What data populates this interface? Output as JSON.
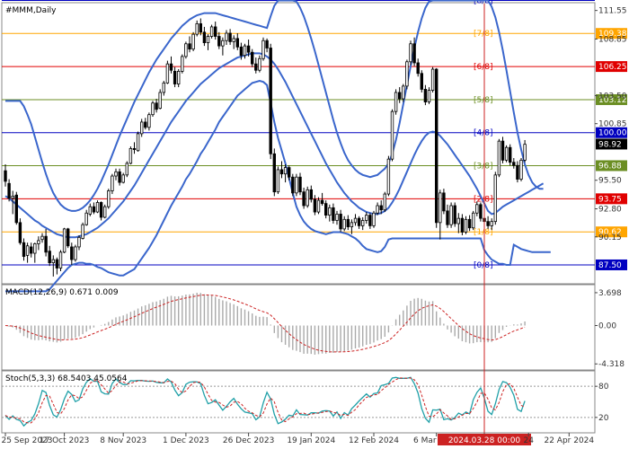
{
  "chart_data": {
    "type": "candlestick",
    "title": "#MMM,Daily",
    "price_ylim": [
      85.8,
      112.2
    ],
    "price_ticks": [
      111.55,
      108.85,
      103.5,
      100.85,
      95.5,
      92.8,
      90.15
    ],
    "x_tick_labels": [
      "25 Sep 2023",
      "17 Oct 2023",
      "8 Nov 2023",
      "1 Dec 2023",
      "26 Dec 2023",
      "19 Jan 2024",
      "12 Feb 2024",
      "6 Mar 2024",
      "2024.03.28 00:00",
      "24",
      "22 Apr 2024"
    ],
    "x_tick_indices": [
      0,
      16,
      32,
      49,
      66,
      83,
      100,
      117,
      130,
      142,
      153
    ],
    "crosshair_index": 130,
    "current_price": 98.92,
    "murrey_levels": [
      {
        "label": "[8/8]",
        "value": 112.5,
        "price_label": "",
        "color": "#0000c0"
      },
      {
        "label": "[7/8]",
        "value": 109.38,
        "price_label": "109.38",
        "color": "#ffa500"
      },
      {
        "label": "[6/8]",
        "value": 106.25,
        "price_label": "106.25",
        "color": "#e00000"
      },
      {
        "label": "[5/8]",
        "value": 103.12,
        "price_label": "103.12",
        "color": "#6b8e23"
      },
      {
        "label": "[4/8]",
        "value": 100.0,
        "price_label": "100.00",
        "color": "#0000c0"
      },
      {
        "label": "[3/8]",
        "value": 96.88,
        "price_label": "96.88",
        "color": "#6b8e23"
      },
      {
        "label": "[2/8]",
        "value": 93.75,
        "price_label": "93.75",
        "color": "#e00000"
      },
      {
        "label": "[1/8]",
        "value": 90.62,
        "price_label": "90.62",
        "color": "#ffa500"
      },
      {
        "label": "[0/8]",
        "value": 87.5,
        "price_label": "87.50",
        "color": "#0000c0"
      }
    ],
    "macd": {
      "label": "MACD(12,26,9) 0.671 0.009",
      "ylim": [
        -4.9,
        4.5
      ],
      "ticks": [
        3.698,
        0.0,
        -4.318
      ]
    },
    "stoch": {
      "label": "Stoch(5,3,3) 68.5403 45.0564",
      "ylim": [
        -8,
        108
      ],
      "ticks": [
        80,
        20
      ],
      "levels": [
        80,
        20
      ]
    },
    "candles": [
      [
        96.4,
        97.0,
        94.9,
        95.4
      ],
      [
        95.2,
        95.6,
        93.5,
        93.8
      ],
      [
        93.8,
        94.5,
        92.3,
        94.0
      ],
      [
        94.1,
        94.4,
        91.3,
        91.5
      ],
      [
        91.5,
        91.9,
        89.4,
        89.6
      ],
      [
        89.6,
        90.0,
        87.9,
        88.3
      ],
      [
        88.4,
        89.6,
        87.7,
        89.3
      ],
      [
        89.2,
        89.6,
        88.2,
        88.6
      ],
      [
        88.6,
        89.6,
        87.7,
        89.5
      ],
      [
        89.5,
        90.2,
        88.9,
        89.8
      ],
      [
        89.9,
        90.5,
        89.6,
        90.2
      ],
      [
        90.2,
        90.9,
        88.3,
        88.7
      ],
      [
        88.8,
        89.3,
        87.4,
        87.7
      ],
      [
        87.7,
        88.4,
        86.4,
        88.0
      ],
      [
        88.0,
        88.2,
        86.6,
        87.2
      ],
      [
        87.2,
        88.9,
        86.9,
        88.7
      ],
      [
        88.7,
        91.0,
        88.6,
        90.9
      ],
      [
        90.9,
        91.0,
        89.1,
        89.3
      ],
      [
        89.2,
        89.6,
        87.5,
        88.0
      ],
      [
        88.0,
        89.4,
        87.8,
        89.2
      ],
      [
        89.2,
        90.3,
        88.9,
        90.1
      ],
      [
        90.0,
        91.5,
        89.9,
        91.3
      ],
      [
        91.3,
        92.7,
        91.2,
        92.4
      ],
      [
        92.3,
        93.3,
        92.1,
        93.0
      ],
      [
        93.0,
        93.4,
        92.3,
        92.5
      ],
      [
        92.5,
        93.6,
        92.4,
        93.4
      ],
      [
        93.4,
        93.5,
        91.7,
        92.0
      ],
      [
        92.0,
        93.2,
        91.9,
        93.0
      ],
      [
        93.0,
        94.7,
        92.8,
        94.5
      ],
      [
        94.5,
        96.1,
        94.2,
        95.9
      ],
      [
        95.9,
        96.6,
        95.5,
        96.3
      ],
      [
        96.3,
        96.6,
        95.0,
        95.3
      ],
      [
        95.3,
        96.2,
        95.2,
        96.0
      ],
      [
        96.0,
        97.3,
        95.8,
        97.1
      ],
      [
        97.1,
        98.7,
        97.0,
        98.5
      ],
      [
        98.5,
        99.1,
        98.0,
        98.4
      ],
      [
        98.3,
        100.1,
        98.2,
        99.9
      ],
      [
        99.9,
        101.3,
        99.6,
        101.0
      ],
      [
        101.0,
        101.4,
        100.3,
        100.5
      ],
      [
        100.5,
        101.9,
        100.2,
        101.7
      ],
      [
        101.7,
        103.0,
        101.5,
        102.8
      ],
      [
        102.8,
        103.2,
        101.9,
        102.2
      ],
      [
        102.3,
        104.1,
        102.2,
        103.8
      ],
      [
        103.8,
        104.9,
        103.5,
        104.7
      ],
      [
        104.7,
        106.8,
        104.6,
        106.5
      ],
      [
        106.5,
        107.2,
        105.6,
        105.9
      ],
      [
        105.8,
        106.2,
        104.3,
        104.6
      ],
      [
        104.6,
        106.0,
        104.3,
        105.8
      ],
      [
        105.8,
        107.4,
        105.6,
        107.2
      ],
      [
        107.2,
        108.6,
        107.0,
        108.4
      ],
      [
        108.4,
        109.1,
        107.6,
        107.9
      ],
      [
        107.9,
        109.5,
        107.7,
        109.3
      ],
      [
        109.3,
        110.6,
        109.1,
        110.3
      ],
      [
        110.3,
        110.8,
        109.2,
        109.5
      ],
      [
        109.5,
        110.0,
        108.2,
        108.5
      ],
      [
        108.5,
        109.3,
        107.8,
        109.1
      ],
      [
        109.1,
        110.2,
        108.9,
        110.0
      ],
      [
        110.0,
        110.5,
        108.8,
        109.1
      ],
      [
        109.1,
        109.5,
        107.9,
        108.2
      ],
      [
        108.2,
        109.0,
        107.3,
        108.7
      ],
      [
        108.7,
        109.7,
        108.3,
        109.4
      ],
      [
        109.4,
        109.8,
        108.3,
        108.6
      ],
      [
        108.6,
        109.2,
        107.9,
        108.9
      ],
      [
        108.9,
        109.4,
        107.8,
        108.1
      ],
      [
        108.1,
        108.5,
        106.9,
        107.3
      ],
      [
        107.3,
        108.4,
        107.0,
        108.2
      ],
      [
        108.2,
        108.8,
        107.2,
        107.6
      ],
      [
        107.6,
        107.9,
        106.2,
        106.5
      ],
      [
        106.5,
        107.1,
        105.6,
        105.9
      ],
      [
        105.9,
        107.3,
        105.7,
        107.0
      ],
      [
        107.0,
        109.0,
        106.8,
        108.7
      ],
      [
        108.7,
        108.9,
        107.6,
        108.0
      ],
      [
        108.0,
        108.4,
        97.5,
        98.0
      ],
      [
        98.0,
        98.5,
        94.0,
        94.4
      ],
      [
        94.4,
        96.8,
        94.2,
        96.5
      ],
      [
        96.5,
        97.3,
        95.7,
        96.1
      ],
      [
        96.1,
        97.0,
        95.3,
        96.7
      ],
      [
        96.7,
        96.9,
        95.5,
        95.8
      ],
      [
        95.8,
        96.1,
        94.0,
        94.3
      ],
      [
        94.3,
        96.1,
        94.0,
        95.8
      ],
      [
        95.8,
        96.2,
        94.1,
        94.4
      ],
      [
        94.4,
        94.8,
        92.8,
        93.1
      ],
      [
        93.1,
        94.9,
        92.9,
        94.6
      ],
      [
        94.6,
        95.0,
        93.4,
        93.7
      ],
      [
        93.7,
        94.1,
        92.2,
        92.5
      ],
      [
        92.5,
        93.9,
        92.3,
        93.6
      ],
      [
        93.6,
        94.3,
        93.1,
        93.3
      ],
      [
        93.3,
        93.6,
        91.9,
        92.2
      ],
      [
        92.2,
        93.2,
        91.6,
        92.9
      ],
      [
        92.9,
        93.3,
        91.4,
        91.7
      ],
      [
        91.7,
        92.6,
        91.3,
        92.3
      ],
      [
        92.3,
        92.7,
        90.6,
        90.9
      ],
      [
        90.9,
        92.1,
        90.7,
        91.8
      ],
      [
        91.8,
        92.2,
        90.8,
        91.1
      ],
      [
        91.1,
        91.8,
        90.4,
        91.5
      ],
      [
        91.5,
        92.3,
        91.2,
        91.9
      ],
      [
        91.9,
        92.1,
        90.9,
        91.2
      ],
      [
        91.2,
        92.0,
        90.8,
        91.7
      ],
      [
        91.7,
        92.5,
        91.4,
        92.2
      ],
      [
        92.2,
        92.4,
        90.9,
        91.2
      ],
      [
        91.2,
        92.6,
        91.0,
        92.4
      ],
      [
        92.4,
        93.4,
        92.2,
        93.1
      ],
      [
        93.1,
        93.6,
        92.3,
        92.7
      ],
      [
        92.7,
        94.4,
        92.5,
        94.2
      ],
      [
        94.2,
        97.8,
        94.0,
        97.5
      ],
      [
        97.5,
        102.2,
        97.3,
        102.0
      ],
      [
        102.0,
        104.1,
        101.7,
        103.8
      ],
      [
        103.8,
        104.3,
        102.8,
        103.2
      ],
      [
        103.2,
        104.6,
        102.9,
        104.4
      ],
      [
        104.4,
        106.9,
        104.1,
        106.7
      ],
      [
        106.7,
        108.7,
        106.4,
        108.4
      ],
      [
        108.4,
        109.0,
        106.3,
        106.6
      ],
      [
        106.6,
        107.0,
        105.3,
        105.6
      ],
      [
        105.6,
        105.9,
        103.8,
        104.1
      ],
      [
        104.1,
        104.5,
        102.6,
        102.9
      ],
      [
        102.9,
        104.3,
        102.7,
        104.0
      ],
      [
        104.0,
        106.2,
        103.8,
        106.0
      ],
      [
        106.0,
        106.1,
        91.0,
        91.5
      ],
      [
        91.5,
        94.6,
        89.9,
        94.3
      ],
      [
        94.3,
        94.7,
        92.3,
        92.6
      ],
      [
        92.6,
        93.2,
        91.0,
        91.3
      ],
      [
        91.3,
        93.4,
        91.0,
        93.1
      ],
      [
        93.1,
        93.4,
        91.1,
        91.4
      ],
      [
        91.4,
        92.4,
        90.5,
        91.9
      ],
      [
        91.9,
        92.3,
        90.3,
        90.6
      ],
      [
        90.6,
        92.1,
        90.4,
        91.8
      ],
      [
        91.8,
        92.2,
        90.7,
        91.0
      ],
      [
        91.0,
        92.6,
        90.8,
        92.4
      ],
      [
        92.4,
        93.5,
        92.1,
        93.2
      ],
      [
        93.2,
        93.4,
        91.6,
        91.9
      ],
      [
        91.9,
        92.3,
        91.1,
        91.6
      ],
      [
        91.6,
        92.1,
        90.9,
        91.2
      ],
      [
        91.2,
        91.9,
        90.8,
        91.6
      ],
      [
        91.6,
        96.3,
        91.3,
        96.0
      ],
      [
        96.0,
        99.4,
        95.8,
        99.2
      ],
      [
        99.2,
        99.6,
        97.1,
        97.4
      ],
      [
        97.4,
        98.8,
        97.2,
        98.6
      ],
      [
        98.6,
        98.9,
        96.9,
        97.2
      ],
      [
        97.2,
        97.6,
        96.6,
        96.9
      ],
      [
        96.9,
        97.3,
        95.3,
        95.6
      ],
      [
        95.6,
        97.6,
        95.4,
        97.4
      ],
      [
        97.4,
        99.3,
        97.2,
        98.9
      ]
    ],
    "bb_upper": [
      103.0,
      103.0,
      103.0,
      103.0,
      103.0,
      102.5,
      101.7,
      100.8,
      99.6,
      98.4,
      97.2,
      96.1,
      95.1,
      94.3,
      93.7,
      93.2,
      92.9,
      92.7,
      92.6,
      92.6,
      92.7,
      92.9,
      93.2,
      93.6,
      94.1,
      94.7,
      95.4,
      96.2,
      97.0,
      97.9,
      98.8,
      99.7,
      100.5,
      101.3,
      102.1,
      102.9,
      103.6,
      104.3,
      105.0,
      105.7,
      106.3,
      106.9,
      107.4,
      107.9,
      108.4,
      108.9,
      109.3,
      109.7,
      110.1,
      110.4,
      110.7,
      110.9,
      111.1,
      111.2,
      111.3,
      111.3,
      111.3,
      111.3,
      111.2,
      111.1,
      111.0,
      110.9,
      110.8,
      110.7,
      110.6,
      110.5,
      110.4,
      110.3,
      110.2,
      110.1,
      110.0,
      109.9,
      111.0,
      112.0,
      112.5,
      112.5,
      112.5,
      112.5,
      112.5,
      112.4,
      111.8,
      111.0,
      110.0,
      108.9,
      107.7,
      106.4,
      105.1,
      103.8,
      102.5,
      101.2,
      100.0,
      99.0,
      98.1,
      97.4,
      96.9,
      96.5,
      96.2,
      96.0,
      95.9,
      95.8,
      95.9,
      96.0,
      96.3,
      96.6,
      97.1,
      98.0,
      99.3,
      100.9,
      102.7,
      104.5,
      106.3,
      108.0,
      109.5,
      110.8,
      111.8,
      112.4,
      112.5,
      112.5,
      112.5,
      112.5,
      112.5,
      112.5,
      112.5,
      112.5,
      112.5,
      112.5,
      112.5,
      112.5,
      112.5,
      112.5,
      112.5,
      112.5,
      111.9,
      110.9,
      109.5,
      107.8,
      105.9,
      103.9,
      101.9,
      100.0,
      98.4,
      97.0,
      96.0,
      95.3,
      94.9,
      94.7,
      94.7
    ],
    "bb_mid": [
      94.0,
      93.8,
      93.5,
      93.2,
      92.9,
      92.6,
      92.3,
      92.0,
      91.7,
      91.5,
      91.2,
      91.0,
      90.8,
      90.6,
      90.4,
      90.3,
      90.2,
      90.1,
      90.1,
      90.1,
      90.2,
      90.3,
      90.4,
      90.6,
      90.8,
      91.0,
      91.3,
      91.6,
      91.9,
      92.3,
      92.7,
      93.1,
      93.5,
      94.0,
      94.5,
      95.0,
      95.6,
      96.2,
      96.8,
      97.4,
      98.0,
      98.6,
      99.2,
      99.8,
      100.4,
      101.0,
      101.5,
      102.0,
      102.5,
      103.0,
      103.4,
      103.8,
      104.2,
      104.6,
      104.9,
      105.2,
      105.5,
      105.8,
      106.1,
      106.3,
      106.5,
      106.7,
      106.9,
      107.1,
      107.2,
      107.3,
      107.4,
      107.5,
      107.5,
      107.5,
      107.4,
      107.2,
      106.9,
      106.5,
      106.0,
      105.4,
      104.8,
      104.1,
      103.4,
      102.7,
      102.0,
      101.3,
      100.6,
      99.9,
      99.2,
      98.5,
      97.8,
      97.1,
      96.5,
      95.9,
      95.3,
      94.8,
      94.3,
      93.9,
      93.5,
      93.2,
      92.9,
      92.7,
      92.5,
      92.4,
      92.3,
      92.3,
      92.4,
      92.6,
      92.9,
      93.4,
      94.0,
      94.7,
      95.5,
      96.3,
      97.1,
      97.9,
      98.6,
      99.2,
      99.7,
      100.0,
      100.1,
      100.0,
      99.7,
      99.3,
      98.9,
      98.4,
      97.9,
      97.4,
      96.9,
      96.4,
      95.9,
      95.3,
      94.7,
      94.0,
      93.3,
      92.6,
      92.3,
      92.4,
      92.7,
      93.0,
      93.2,
      93.4,
      93.6,
      93.8,
      94.0,
      94.2,
      94.4,
      94.6,
      94.8,
      95.0,
      95.2
    ],
    "bb_lower": [
      85.0,
      85.0,
      85.0,
      85.0,
      85.0,
      85.0,
      85.0,
      85.0,
      85.0,
      85.0,
      85.0,
      85.0,
      85.2,
      85.6,
      86.0,
      86.4,
      86.8,
      87.2,
      87.5,
      87.6,
      87.7,
      87.7,
      87.6,
      87.6,
      87.5,
      87.3,
      87.2,
      87.0,
      86.8,
      86.7,
      86.6,
      86.5,
      86.5,
      86.7,
      86.9,
      87.1,
      87.6,
      88.1,
      88.6,
      89.1,
      89.7,
      90.3,
      91.0,
      91.7,
      92.4,
      93.1,
      93.7,
      94.3,
      94.9,
      95.6,
      96.1,
      96.7,
      97.3,
      98.0,
      98.5,
      99.1,
      99.7,
      100.3,
      101.0,
      101.5,
      102.0,
      102.5,
      103.0,
      103.5,
      103.8,
      104.1,
      104.4,
      104.7,
      104.8,
      104.9,
      104.8,
      104.5,
      102.8,
      101.0,
      99.5,
      98.3,
      97.1,
      95.7,
      94.3,
      93.0,
      92.2,
      91.6,
      91.2,
      90.9,
      90.7,
      90.6,
      90.5,
      90.4,
      90.5,
      90.6,
      90.6,
      90.6,
      90.5,
      90.4,
      90.2,
      90.0,
      89.7,
      89.3,
      89.0,
      88.9,
      88.8,
      88.7,
      88.8,
      89.2,
      89.9,
      90.0,
      90.0,
      90.0,
      90.0,
      90.0,
      90.0,
      90.0,
      90.0,
      90.0,
      90.0,
      90.0,
      90.0,
      90.0,
      90.0,
      90.0,
      90.0,
      90.0,
      90.0,
      90.0,
      90.0,
      90.0,
      90.0,
      90.0,
      90.0,
      90.0,
      88.9,
      88.4,
      88.0,
      87.8,
      87.6,
      87.6,
      87.5,
      87.5,
      89.4,
      89.2,
      89.0,
      88.9,
      88.8,
      88.7,
      88.7,
      88.7,
      88.7,
      88.7,
      88.7
    ]
  }
}
